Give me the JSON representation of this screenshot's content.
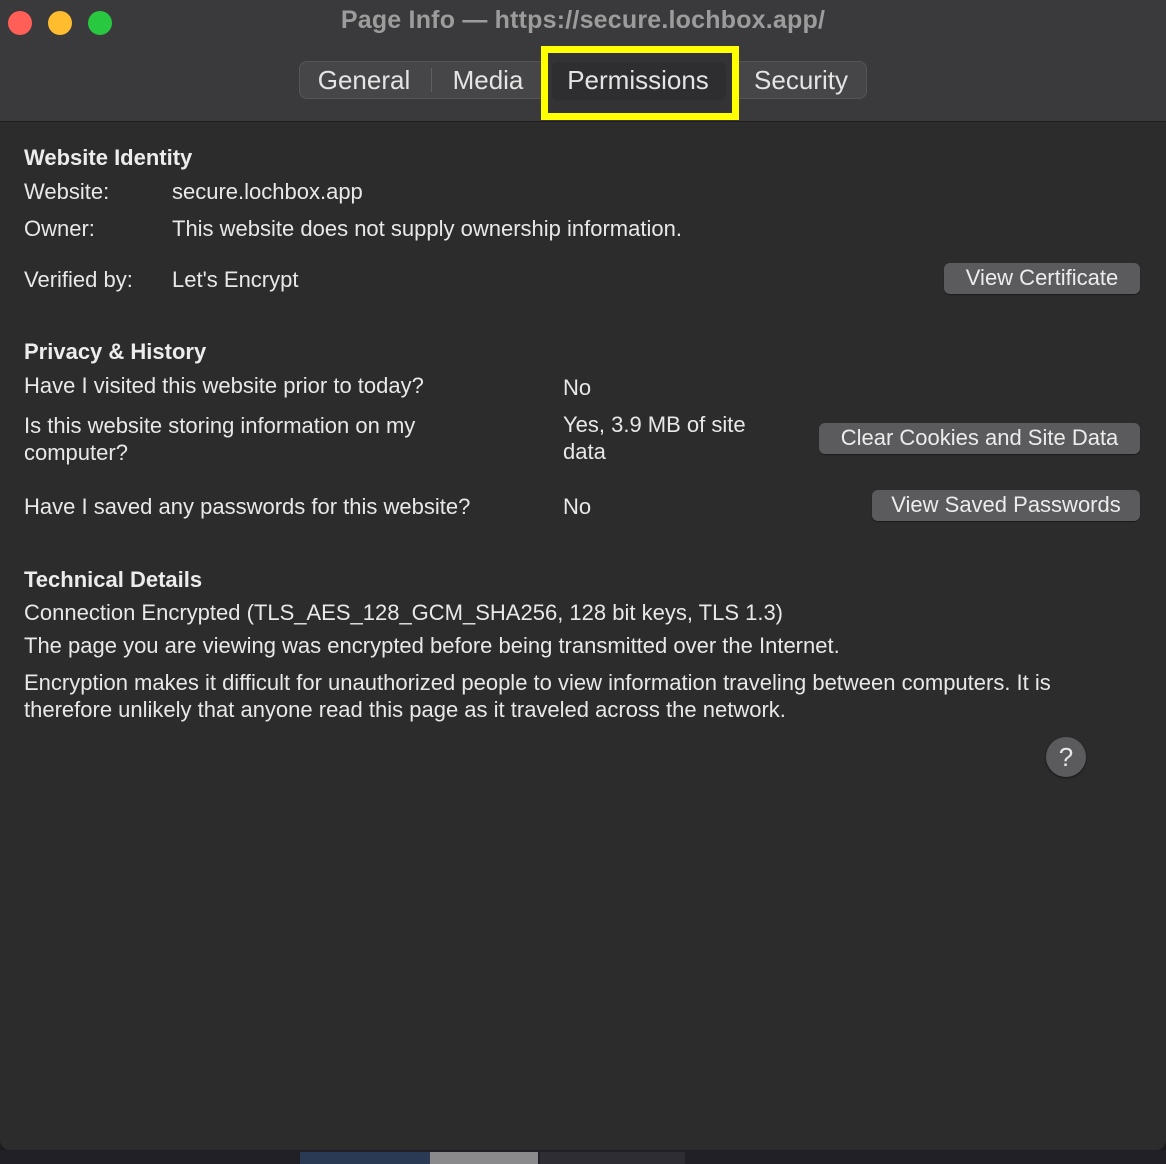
{
  "window": {
    "title": "Page Info — https://secure.lochbox.app/"
  },
  "tabs": [
    {
      "label": "General"
    },
    {
      "label": "Media"
    },
    {
      "label": "Permissions"
    },
    {
      "label": "Security"
    }
  ],
  "identity": {
    "heading": "Website Identity",
    "website_label": "Website:",
    "website_value": "secure.lochbox.app",
    "owner_label": "Owner:",
    "owner_value": "This website does not supply ownership information.",
    "verified_label": "Verified by:",
    "verified_value": "Let's Encrypt",
    "view_certificate_label": "View Certificate"
  },
  "privacy": {
    "heading": "Privacy & History",
    "q1": "Have I visited this website prior to today?",
    "a1": "No",
    "q2_line1": "Is this website storing information on my",
    "q2_line2": "computer?",
    "a2_line1": "Yes, 3.9 MB of site",
    "a2_line2": "data",
    "clear_cookies_label": "Clear Cookies and Site Data",
    "q3": "Have I saved any passwords for this website?",
    "a3": "No",
    "view_passwords_label": "View Saved Passwords"
  },
  "technical": {
    "heading": "Technical Details",
    "connection": "Connection Encrypted (TLS_AES_128_GCM_SHA256, 128 bit keys, TLS 1.3)",
    "line1": "The page you are viewing was encrypted before being transmitted over the Internet.",
    "line2a": "Encryption makes it difficult for unauthorized people to view information traveling between computers. It is",
    "line2b": "therefore unlikely that anyone read this page as it traveled across the network."
  },
  "help": {
    "label": "?"
  },
  "colors": {
    "highlight": "#ffff00",
    "close": "#ff5f57",
    "minimize": "#febc2e",
    "maximize": "#28c840"
  }
}
